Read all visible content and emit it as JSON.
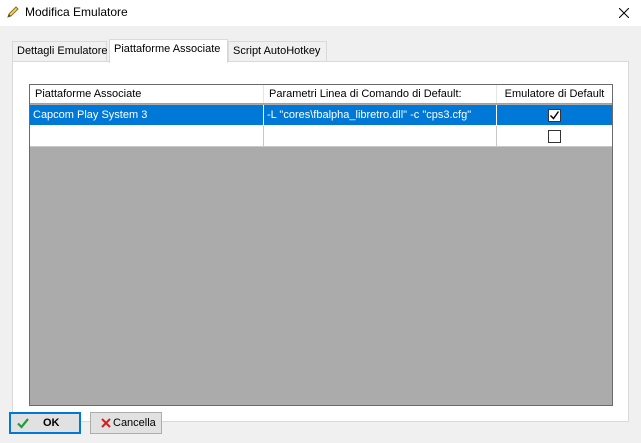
{
  "window": {
    "title": "Modifica Emulatore",
    "icon": "pencil-icon",
    "close_icon": "close-icon"
  },
  "tabs": [
    {
      "label": "Dettagli Emulatore",
      "active": false
    },
    {
      "label": "Piattaforme Associate",
      "active": true
    },
    {
      "label": "Script AutoHotkey",
      "active": false
    }
  ],
  "grid": {
    "columns": [
      "Piattaforme Associate",
      "Parametri Linea di Comando di Default:",
      "Emulatore di Default"
    ],
    "rows": [
      {
        "platform": "Capcom Play System 3",
        "params": "-L \"cores\\fbalpha_libretro.dll\" -c \"cps3.cfg\"",
        "default": true,
        "selected": true
      },
      {
        "platform": "",
        "params": "",
        "default": false,
        "selected": false
      }
    ]
  },
  "buttons": {
    "ok_label": "OK",
    "cancel_label": "Cancella"
  },
  "colors": {
    "selection": "#0078d7",
    "grid_background": "#ababab",
    "dialog_background": "#f0f0f0",
    "ok_check": "#1e9e3a",
    "cancel_x": "#d42020"
  }
}
